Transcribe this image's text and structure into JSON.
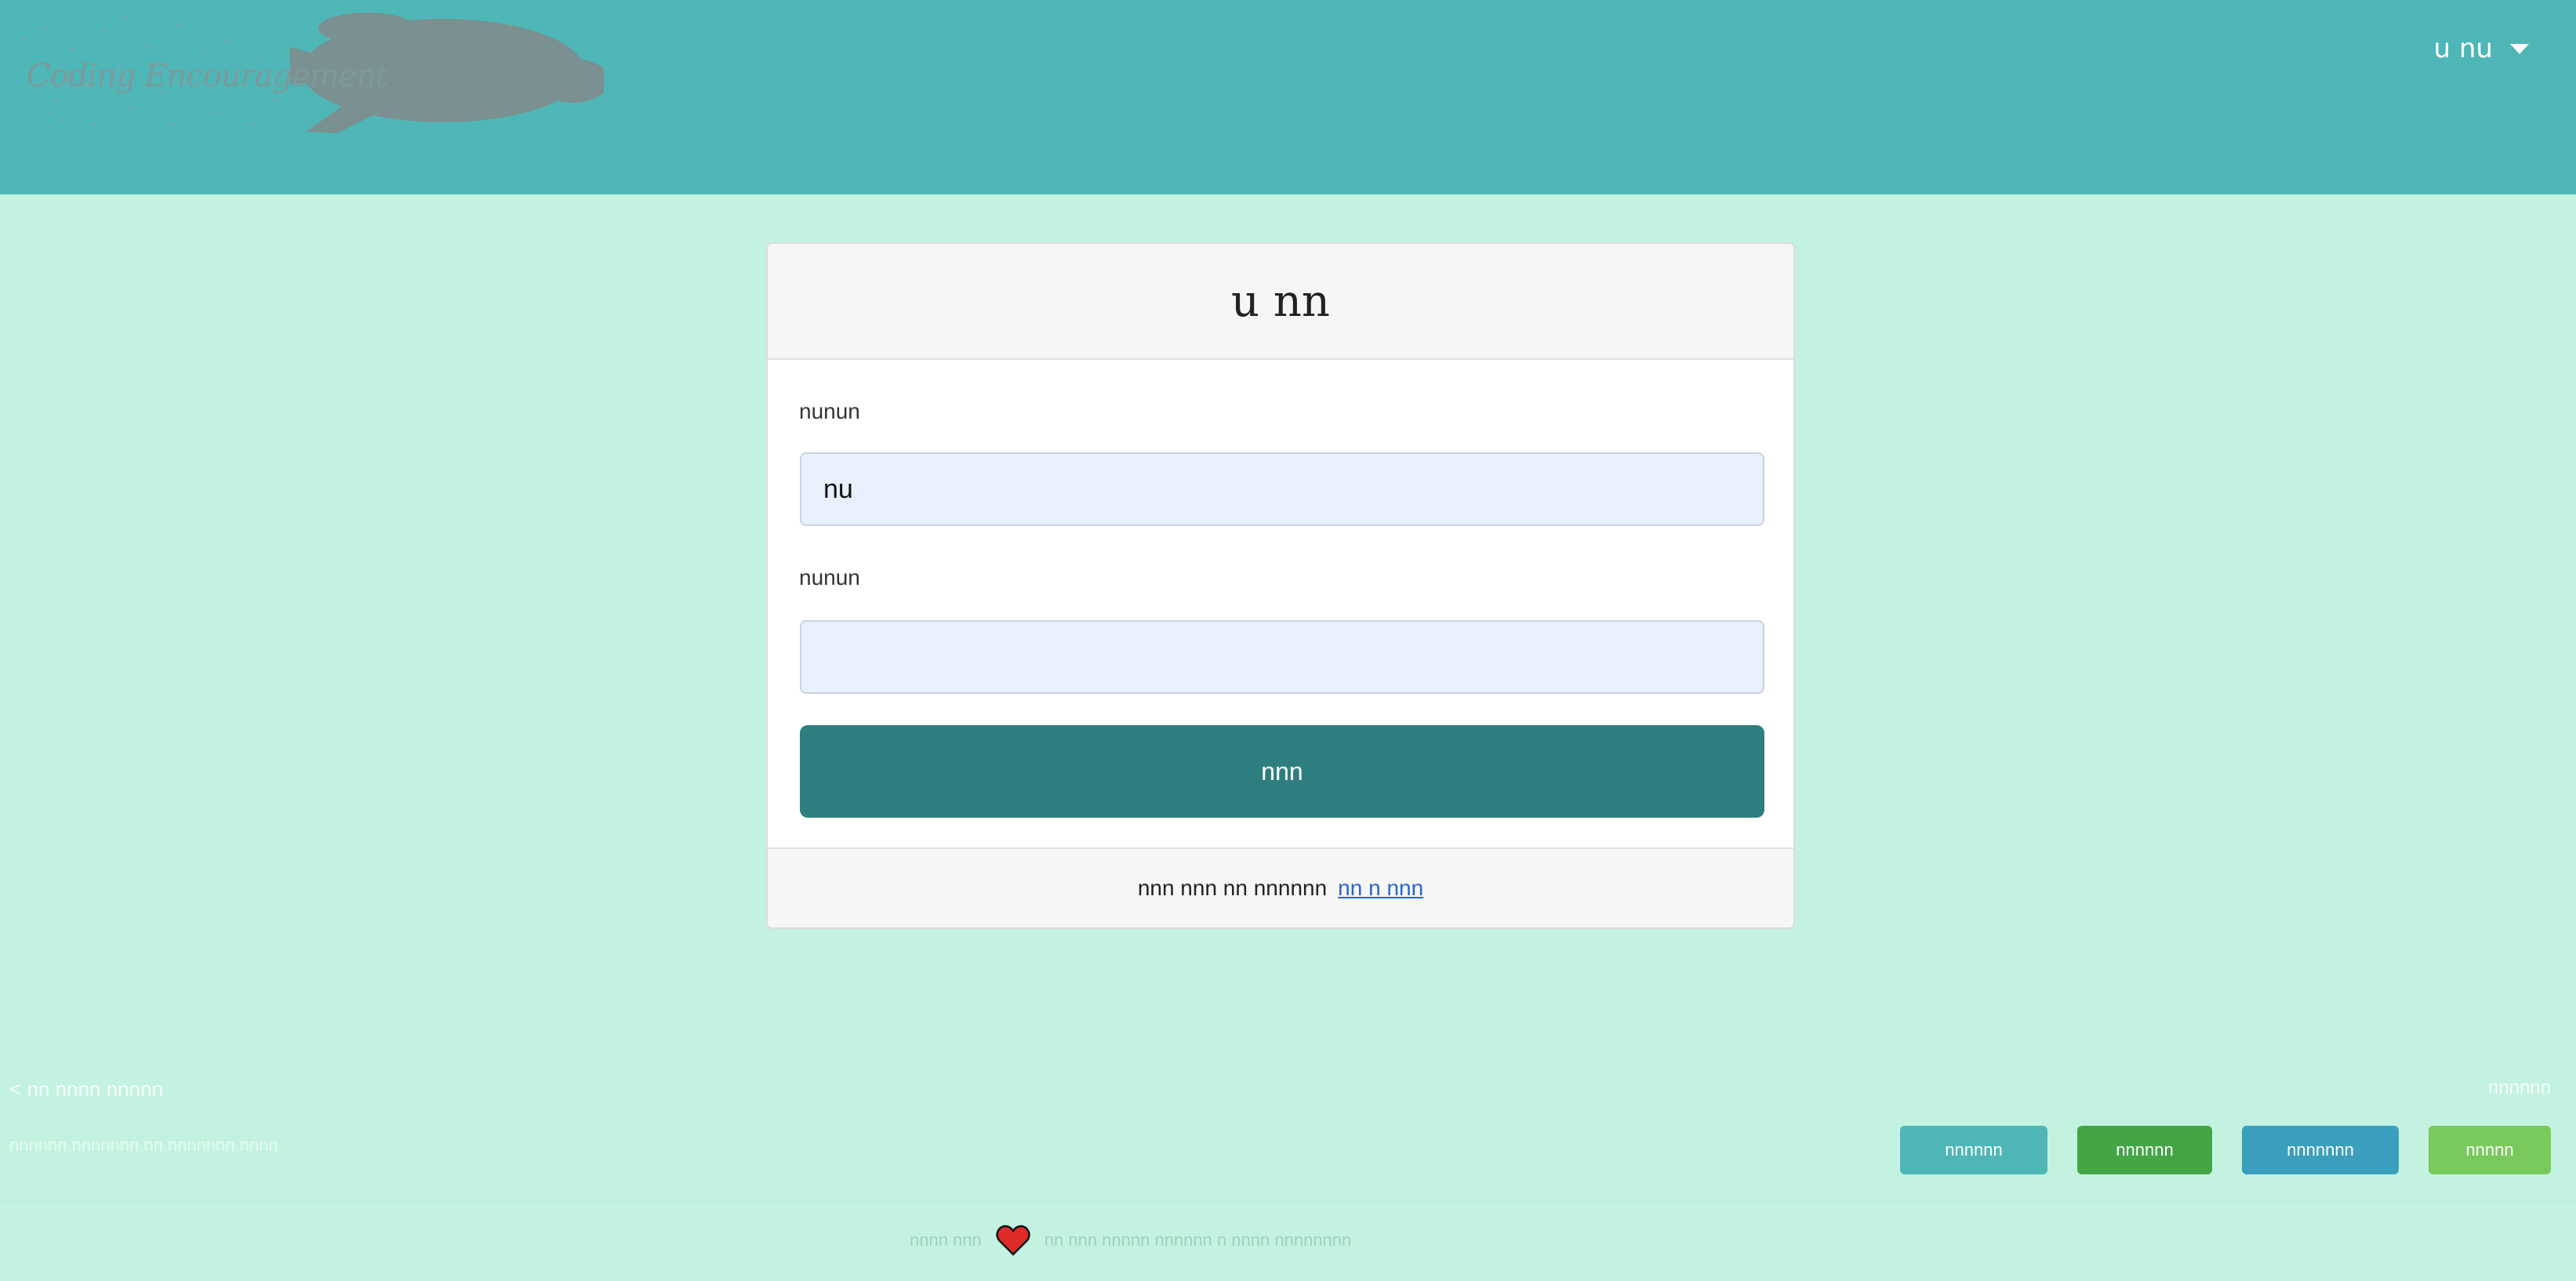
{
  "header": {
    "brand": "Coding Encouragement",
    "user_menu_label": "u nu",
    "icons": {
      "caret": "chevron-down-icon",
      "logo": "turtle-logo-icon"
    }
  },
  "login": {
    "title": "u nn",
    "username_label": "nunun",
    "username_value": "nu",
    "password_label": "nunun",
    "password_value": "",
    "submit_label": "nnn",
    "footer_text": "nnn nnn nn nnnnnn",
    "footer_link": "nn n nnn"
  },
  "page_footer": {
    "credit_line": "< nn nnnn nnnnn",
    "credit_sub": "nnnnnn nnnnnnn nn nnnnnnn nnnn",
    "side_note": "nnnnnn",
    "tags": [
      "nnnnnn",
      "nnnnnn",
      "nnnnnnn",
      "nnnnn"
    ],
    "tag_colors": [
      "#4fb6b7",
      "#44a546",
      "#3a9fbc",
      "#79c95d"
    ],
    "made_with_before": "nnnn nnn",
    "made_with_after": "nn nnn nnnnn nnnnnn n nnnn nnnnnnnn",
    "heart_icon": "heart-icon"
  },
  "colors": {
    "header": "#4fb6b7",
    "background": "#c3f3e0",
    "button": "#2f7e7f",
    "link": "#2a66c9",
    "input_bg": "#e8f0fe"
  }
}
